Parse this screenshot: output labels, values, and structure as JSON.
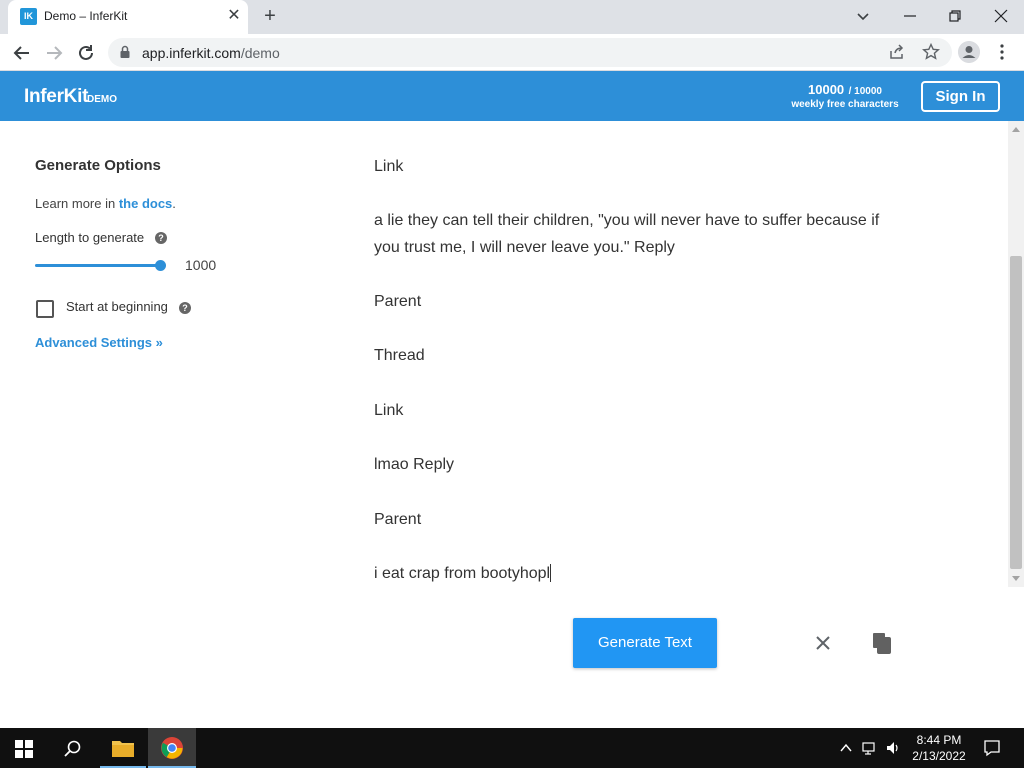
{
  "browser": {
    "tab_title": "Demo – InferKit",
    "tab_favicon_text": "IK",
    "url_domain": "app.inferkit.com",
    "url_path": "/demo"
  },
  "header": {
    "brand": "InferKit",
    "brand_sub": "DEMO",
    "quota_used": "10000",
    "quota_total": "/ 10000",
    "quota_label": "weekly free characters",
    "signin_label": "Sign In"
  },
  "options": {
    "title": "Generate Options",
    "learn_prefix": "Learn more in ",
    "docs_link": "the docs",
    "learn_suffix": ".",
    "length_label": "Length to generate",
    "length_value": "1000",
    "start_label": "Start at beginning",
    "start_checked": false,
    "advanced_label": "Advanced Settings »"
  },
  "editor": {
    "lines": [
      "Link",
      "a lie they can tell their children, \"you will never have to suffer because if",
      "you trust me, I will never leave you.\" Reply",
      "Parent",
      "Thread",
      "Link",
      "lmao Reply",
      "Parent",
      "i eat crap from bootyhopl"
    ]
  },
  "actions": {
    "generate_label": "Generate Text"
  },
  "taskbar": {
    "time": "8:44 PM",
    "date": "2/13/2022"
  },
  "colors": {
    "brand_blue": "#2d8fd8",
    "button_blue": "#2196f3"
  }
}
